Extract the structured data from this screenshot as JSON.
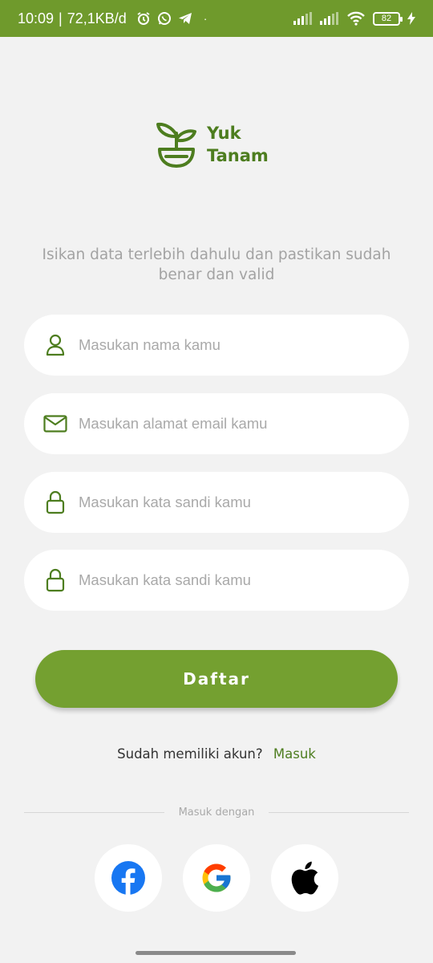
{
  "status_bar": {
    "time": "10:09",
    "speed": "72,1KB/d",
    "battery": "82",
    "icons": [
      "alarm-icon",
      "whatsapp-icon",
      "telegram-icon",
      "signal-icon",
      "signal-icon",
      "wifi-icon",
      "charging-icon"
    ]
  },
  "logo": {
    "line1": "Yuk",
    "line2": "Tanam",
    "icon": "sprout-pot-icon"
  },
  "subtitle": "Isikan data terlebih dahulu dan pastikan sudah benar dan valid",
  "form": {
    "name_placeholder": "Masukan nama kamu",
    "email_placeholder": "Masukan alamat email kamu",
    "password_placeholder": "Masukan kata sandi kamu",
    "confirm_placeholder": "Masukan kata sandi kamu"
  },
  "register_button": "Daftar",
  "login_prompt": {
    "text": "Sudah memiliki akun?",
    "link": "Masuk"
  },
  "divider_label": "Masuk dengan",
  "social": [
    "facebook-icon",
    "google-icon",
    "apple-icon"
  ],
  "colors": {
    "primary": "#74a030",
    "status_bar": "#6f9a2c",
    "logo_green": "#4d7d1f",
    "background": "#f2f2f2"
  }
}
